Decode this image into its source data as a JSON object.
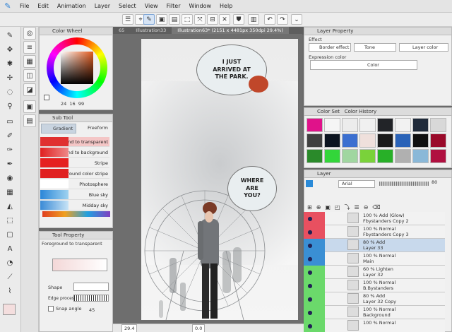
{
  "menu": {
    "items": [
      "File",
      "Edit",
      "Animation",
      "Layer",
      "Select",
      "View",
      "Filter",
      "Window",
      "Help"
    ]
  },
  "tabs": [
    "65",
    "Illustration33",
    "Illustration63* (2151 x 4481px 350dpi 29.4%)"
  ],
  "color_wheel": {
    "title": "Color Wheel",
    "values": [
      "24",
      "16",
      "99"
    ]
  },
  "sub_tool": {
    "title": "Sub Tool",
    "tab_gradient": "Gradient",
    "tab_freeform": "Freeform",
    "items": [
      "Foreground to transparent",
      "Foreground to background",
      "Stripe",
      "Background color stripe",
      "Photosphere",
      "Blue sky",
      "Midday sky"
    ]
  },
  "tool_property": {
    "title": "Tool Property",
    "tool_name": "Foreground to transparent",
    "shape_label": "Shape",
    "edge_label": "Edge process",
    "snap_label": "Snap angle",
    "snap_value": "45"
  },
  "canvas": {
    "bubble1": "I JUST ARRIVED AT THE PARK.",
    "bubble2": "WHERE ARE YOU?",
    "zoom": "29.4",
    "rotation": "0.0"
  },
  "layer_property": {
    "title": "Layer Property",
    "effect_label": "Effect",
    "border_effect": "Border effect",
    "tone": "Tone",
    "layer_color": "Layer color",
    "expression_label": "Expression color",
    "color_value": "Color"
  },
  "color_history": {
    "tab1": "Color Set",
    "tab2": "Color History",
    "colors": [
      "#e0128a",
      "#f5f5f5",
      "#ececec",
      "#f0f0f0",
      "#222428",
      "#f2f2f2",
      "#1f2a3a",
      "#d8d8d8",
      "#404040",
      "#0c1420",
      "#3b6fd0",
      "#efe0dc",
      "#1a1a1a",
      "#2a63b8",
      "#101010",
      "#9a0a2a",
      "#2a8a2a",
      "#33d63a",
      "#a0d6a0",
      "#7ad23a",
      "#28b028",
      "#b0b0b0",
      "#8ab8d8",
      "#b01040"
    ]
  },
  "layers": {
    "title": "Layer",
    "blend": "Arial",
    "opacity": "80",
    "rows": [
      {
        "l1": "100 % Add (Glow)",
        "l2": "Fbystanders Copy 2",
        "color": "#e85060"
      },
      {
        "l1": "100 % Normal",
        "l2": "Fbystanders Copy 3",
        "color": "#e85060"
      },
      {
        "l1": "80 % Add",
        "l2": "Layer 33",
        "color": "#3a8fd4"
      },
      {
        "l1": "100 % Normal",
        "l2": "Main",
        "color": "#3a8fd4"
      },
      {
        "l1": "60 % Lighten",
        "l2": "Layer 32",
        "color": "#6bd96b"
      },
      {
        "l1": "100 % Normal",
        "l2": "B.Bystanders",
        "color": "#6bd96b"
      },
      {
        "l1": "80 % Add",
        "l2": "Layer 32 Copy",
        "color": "#6bd96b"
      },
      {
        "l1": "100 % Normal",
        "l2": "Background",
        "color": "#6bd96b"
      },
      {
        "l1": "100 % Normal",
        "l2": "",
        "color": "#6bd96b"
      }
    ]
  }
}
